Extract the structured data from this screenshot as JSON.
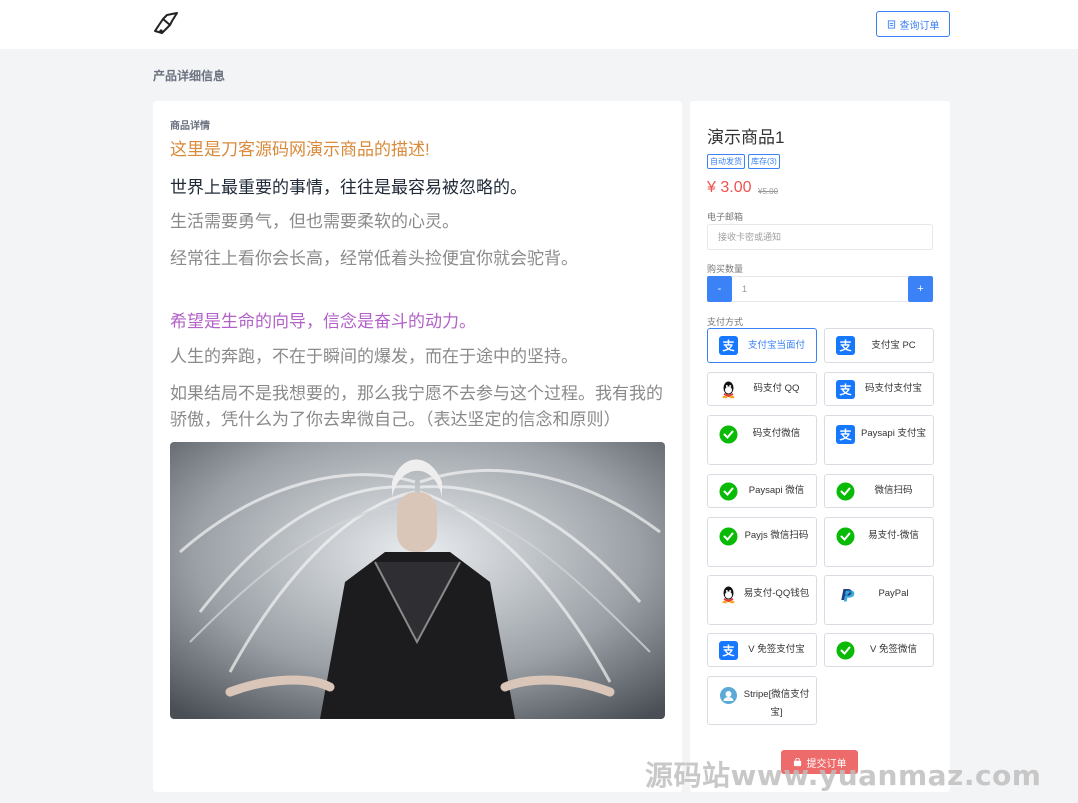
{
  "header": {
    "query_order_label": "查询订单"
  },
  "page": {
    "section_title": "产品详细信息"
  },
  "detail": {
    "label": "商品详情",
    "lines": [
      "这里是刀客源码网演示商品的描述!",
      "世界上最重要的事情，往往是最容易被忽略的。",
      "生活需要勇气，但也需要柔软的心灵。",
      "经常往上看你会长高，经常低着头捡便宜你就会驼背。",
      "希望是生命的向导，信念是奋斗的动力。",
      "人生的奔跑，不在于瞬间的爆发，而在于途中的坚持。",
      "如果结局不是我想要的，那么我宁愿不去参与这个过程。我有我的骄傲，凭什么为了你去卑微自己。（表达坚定的信念和原则）"
    ]
  },
  "product": {
    "name": "演示商品1",
    "tags": [
      "自动发货",
      "库存(3)"
    ],
    "price": "¥ 3.00",
    "old_price": "¥5.00"
  },
  "form": {
    "email_label": "电子邮箱",
    "email_placeholder": "接收卡密或通知",
    "qty_label": "购买数量",
    "qty_value": "1",
    "minus": "-",
    "plus": "+",
    "pay_label": "支付方式"
  },
  "payments": [
    {
      "label": "支付宝当面付",
      "icon": "alipay-icon",
      "selected": true
    },
    {
      "label": "支付宝 PC",
      "icon": "alipay-icon"
    },
    {
      "label": "码支付 QQ",
      "icon": "qq-icon"
    },
    {
      "label": "码支付支付宝",
      "icon": "alipay-icon"
    },
    {
      "label": "码支付微信",
      "icon": "wechat-icon"
    },
    {
      "label": "Paysapi 支付宝",
      "icon": "alipay-icon"
    },
    {
      "label": "Paysapi 微信",
      "icon": "wechat-icon"
    },
    {
      "label": "微信扫码",
      "icon": "wechat-icon"
    },
    {
      "label": "Payjs 微信扫码",
      "icon": "wechat-icon"
    },
    {
      "label": "易支付-微信",
      "icon": "wechat-icon"
    },
    {
      "label": "易支付-QQ钱包",
      "icon": "qq-icon"
    },
    {
      "label": "PayPal",
      "icon": "paypal-icon"
    },
    {
      "label": "V 免签支付宝",
      "icon": "alipay-icon"
    },
    {
      "label": "V 免签微信",
      "icon": "wechat-icon"
    },
    {
      "label": "Stripe[微信支付宝]",
      "icon": "stripe-icon"
    }
  ],
  "submit_label": "提交订单",
  "watermark": "源码站www.yuanmaz.com",
  "colors": {
    "accent": "#3b82f6",
    "price": "#ef5350",
    "submit": "#ee6b6b",
    "alipay": "#1677ff",
    "wechat": "#09bb07"
  }
}
